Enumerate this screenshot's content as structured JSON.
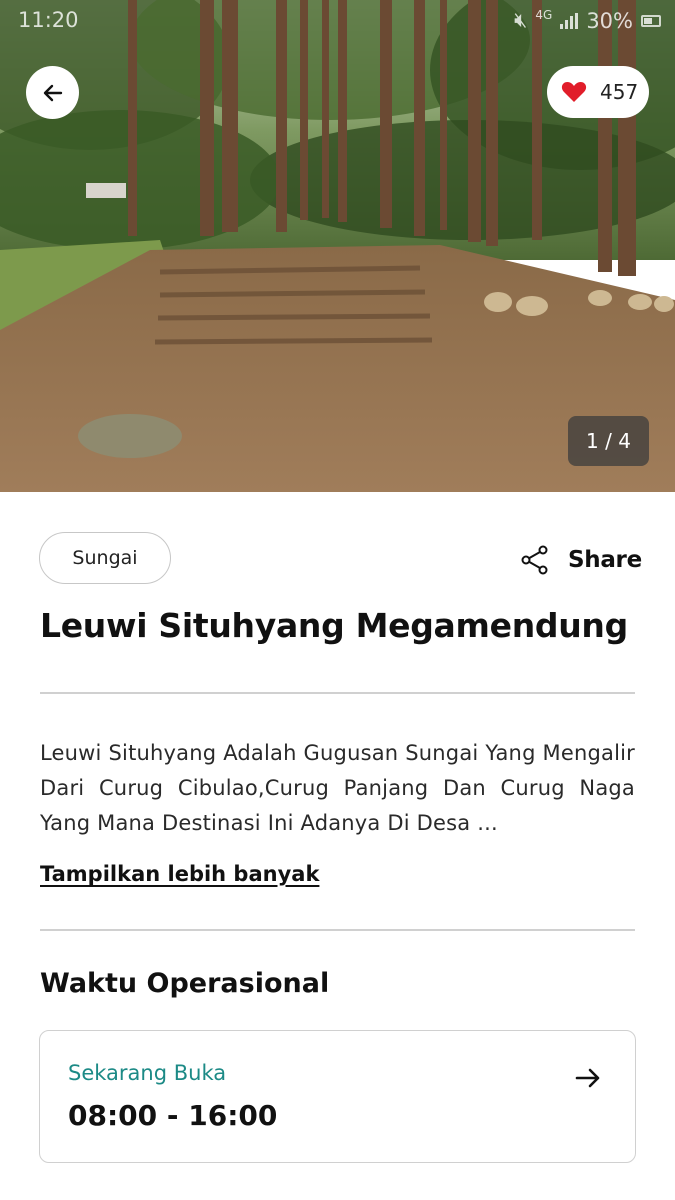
{
  "status_bar": {
    "time": "11:20",
    "network": "4G",
    "battery": "30%"
  },
  "hero": {
    "like_count": "457",
    "photo_counter": "1 / 4",
    "like_color": "#e11d2a"
  },
  "place": {
    "category": "Sungai",
    "share_label": "Share",
    "title": "Leuwi Situhyang Megamendung",
    "description": "Leuwi Situhyang Adalah Gugusan Sungai Yang Mengalir Dari Curug Cibulao,Curug Panjang Dan Curug Naga Yang Mana Destinasi Ini Adanya Di Desa ...",
    "show_more": "Tampilkan lebih banyak"
  },
  "operational": {
    "section_title": "Waktu Operasional",
    "status": "Sekarang Buka",
    "hours": "08:00 - 16:00",
    "status_color": "#1c8a86"
  },
  "icons": {
    "back": "arrow-left-icon",
    "like": "heart-icon",
    "share": "share-icon",
    "detail": "arrow-right-icon"
  }
}
